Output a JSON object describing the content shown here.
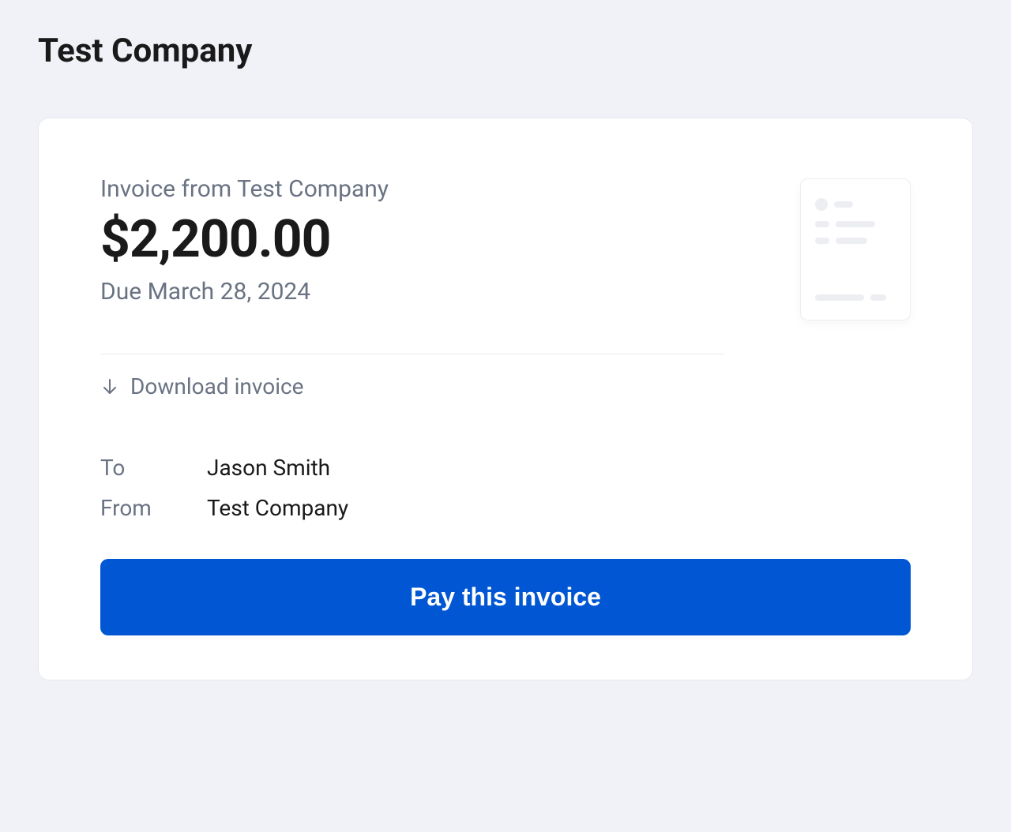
{
  "header": {
    "company_name": "Test Company"
  },
  "invoice": {
    "from_label": "Invoice from Test Company",
    "amount": "$2,200.00",
    "due_label": "Due March 28, 2024",
    "download_label": "Download invoice",
    "to_label": "To",
    "to_value": "Jason Smith",
    "from_field_label": "From",
    "from_field_value": "Test Company",
    "pay_button_label": "Pay this invoice"
  }
}
